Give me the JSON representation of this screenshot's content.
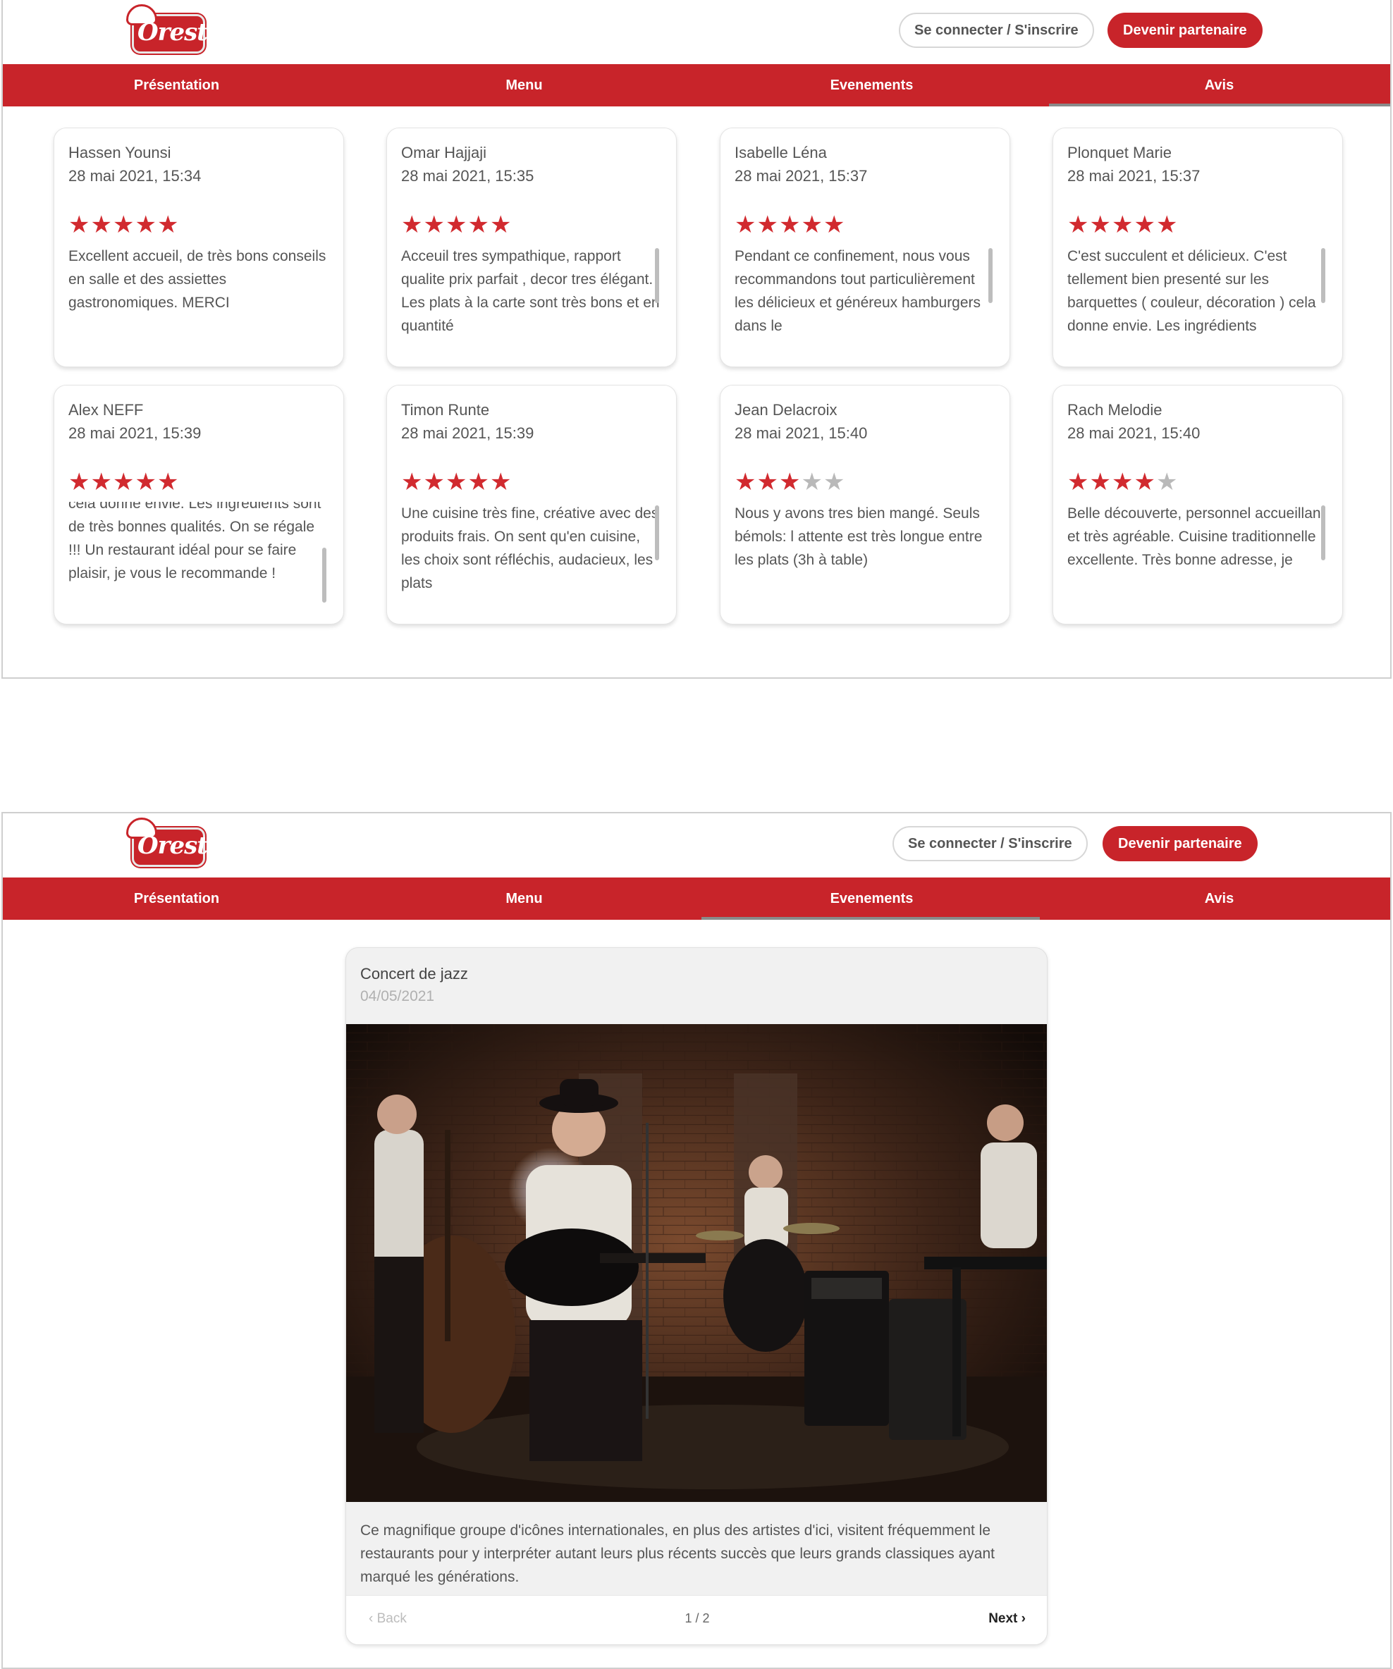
{
  "header": {
    "logo_text": "Oresto",
    "login_label": "Se connecter / S'inscrire",
    "partner_label": "Devenir partenaire"
  },
  "nav": {
    "tabs": [
      "Présentation",
      "Menu",
      "Evenements",
      "Avis"
    ]
  },
  "screens": [
    {
      "active_tab": "Avis"
    },
    {
      "active_tab": "Evenements"
    }
  ],
  "reviews": [
    {
      "author": "Hassen Younsi",
      "date": "28 mai 2021, 15:34",
      "rating": 5,
      "text": "Excellent accueil, de très bons conseils en salle et des assiettes gastronomiques. MERCI"
    },
    {
      "author": "Omar Hajjaji",
      "date": "28 mai 2021, 15:35",
      "rating": 5,
      "text": "Acceuil tres sympathique, rapport qualite prix parfait , decor tres élégant. Les plats à la carte sont très bons et en quantité"
    },
    {
      "author": "Isabelle Léna",
      "date": "28 mai 2021, 15:37",
      "rating": 5,
      "text": "Pendant ce confinement, nous vous recommandons tout particulièrement les délicieux et généreux hamburgers dans le"
    },
    {
      "author": "Plonquet Marie",
      "date": "28 mai 2021, 15:37",
      "rating": 5,
      "text": "C'est succulent et délicieux. C'est tellement bien presenté sur les barquettes ( couleur, décoration ) cela donne envie. Les ingrédients"
    },
    {
      "author": "Alex NEFF",
      "date": "28 mai 2021, 15:39",
      "rating": 5,
      "text": "cela donne envie. Les ingrédients sont de très bonnes qualités. On se régale !!! Un restaurant idéal pour se faire plaisir, je vous le recommande !"
    },
    {
      "author": "Timon Runte",
      "date": "28 mai 2021, 15:39",
      "rating": 5,
      "text": "Une cuisine très fine, créative avec des produits frais. On sent qu'en cuisine, les choix sont réfléchis, audacieux, les plats"
    },
    {
      "author": "Jean Delacroix",
      "date": "28 mai 2021, 15:40",
      "rating": 3,
      "text": "Nous y avons tres bien mangé. Seuls bémols: l attente est très longue entre les plats (3h à table)"
    },
    {
      "author": "Rach Melodie",
      "date": "28 mai 2021, 15:40",
      "rating": 4,
      "text": "Belle découverte, personnel accueillant et très agréable. Cuisine traditionnelle excellente. Très bonne adresse, je"
    }
  ],
  "event": {
    "title": "Concert de jazz",
    "date": "04/05/2021",
    "description": "Ce magnifique groupe d'icônes internationales, en plus des artistes d'ici, visitent fréquemment le restaurants pour y interpréter autant leurs plus récents succès que leurs grands classiques ayant marqué les générations.",
    "back_label": "Back",
    "pagination": "1 / 2",
    "next_label": "Next"
  },
  "colors": {
    "brand_red": "#c8242a",
    "star_active": "#d12a2f",
    "star_inactive": "#b9b9b9"
  }
}
